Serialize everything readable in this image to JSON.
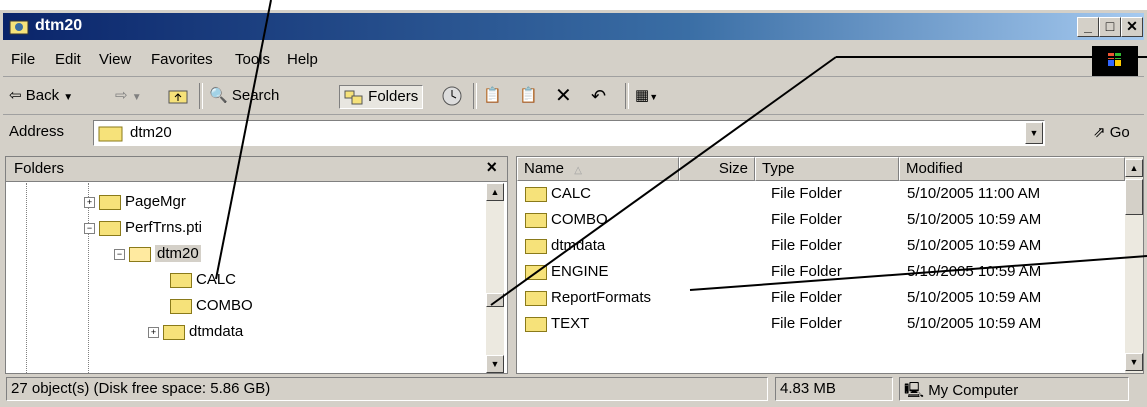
{
  "window": {
    "title": "dtm20"
  },
  "menu": [
    "File",
    "Edit",
    "View",
    "Favorites",
    "Tools",
    "Help"
  ],
  "toolbar": {
    "back": "Back",
    "search": "Search",
    "folders": "Folders"
  },
  "address": {
    "label": "Address",
    "value": "dtm20",
    "go": "Go"
  },
  "folders_pane": {
    "header": "Folders",
    "close": "×",
    "tree": [
      {
        "label": "PageMgr",
        "expander": "+",
        "open": false,
        "selected": false
      },
      {
        "label": "PerfTrns.pti",
        "expander": "−",
        "open": false,
        "selected": false
      },
      {
        "label": "dtm20",
        "expander": "−",
        "open": true,
        "selected": true
      },
      {
        "label": "CALC",
        "expander": "",
        "open": false,
        "selected": false
      },
      {
        "label": "COMBO",
        "expander": "",
        "open": false,
        "selected": false
      },
      {
        "label": "dtmdata",
        "expander": "+",
        "open": false,
        "selected": false
      }
    ]
  },
  "file_list": {
    "columns": [
      "Name",
      "Size",
      "Type",
      "Modified"
    ],
    "rows": [
      {
        "name": "CALC",
        "size": "",
        "type": "File Folder",
        "modified": "5/10/2005 11:00 AM"
      },
      {
        "name": "COMBO",
        "size": "",
        "type": "File Folder",
        "modified": "5/10/2005 10:59 AM"
      },
      {
        "name": "dtmdata",
        "size": "",
        "type": "File Folder",
        "modified": "5/10/2005 10:59 AM"
      },
      {
        "name": "ENGINE",
        "size": "",
        "type": "File Folder",
        "modified": "5/10/2005 10:59 AM"
      },
      {
        "name": "ReportFormats",
        "size": "",
        "type": "File Folder",
        "modified": "5/10/2005 10:59 AM"
      },
      {
        "name": "TEXT",
        "size": "",
        "type": "File Folder",
        "modified": "5/10/2005 10:59 AM"
      }
    ]
  },
  "status": {
    "objects": "27 object(s) (Disk free space: 5.86 GB)",
    "size": "4.83 MB",
    "zone": "My Computer"
  },
  "colors": {
    "title_start": "#0a246a",
    "title_end": "#a6caf0",
    "face": "#d4d0c8",
    "folder": "#f6e27a"
  }
}
